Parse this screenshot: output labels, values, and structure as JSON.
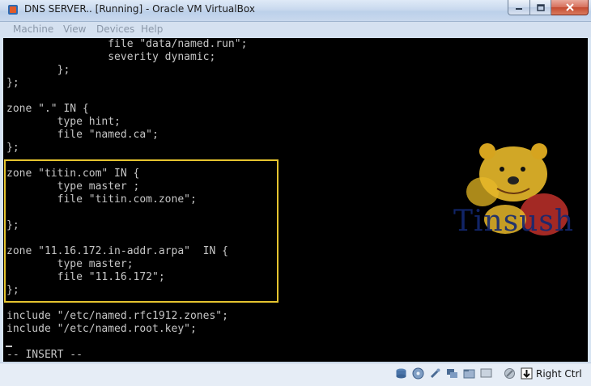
{
  "window": {
    "title": "DNS SERVER.. [Running] - Oracle VM VirtualBox",
    "buttons": {
      "minimize": "minimize-icon",
      "maximize": "maximize-icon",
      "close": "close-icon"
    }
  },
  "menu": {
    "items": [
      {
        "label": "Machine"
      },
      {
        "label": "View"
      },
      {
        "label": "Devices"
      },
      {
        "label": "Help"
      }
    ]
  },
  "console": {
    "lines": [
      "                file \"data/named.run\";",
      "                severity dynamic;",
      "        };",
      "};",
      "",
      "zone \".\" IN {",
      "        type hint;",
      "        file \"named.ca\";",
      "};",
      "",
      "zone \"titin.com\" IN {",
      "        type master ;",
      "        file \"titin.com.zone\";",
      "",
      "};",
      "",
      "zone \"11.16.172.in-addr.arpa\"  IN {",
      "        type master;",
      "        file \"11.16.172\";",
      "};",
      "",
      "include \"/etc/named.rfc1912.zones\";",
      "include \"/etc/named.root.key\";",
      "",
      "-- INSERT --"
    ],
    "highlight_color": "#e5c42f",
    "text_color": "#c6c6c6",
    "background": "#000000"
  },
  "watermark": {
    "text": "Tinsush"
  },
  "statusbar": {
    "icons": [
      "hard-disk-icon",
      "optical-drive-icon",
      "usb-icon",
      "network-icon",
      "shared-folder-icon",
      "display-icon",
      "mouse-integration-icon",
      "host-key-icon"
    ],
    "host_key": "Right Ctrl"
  }
}
